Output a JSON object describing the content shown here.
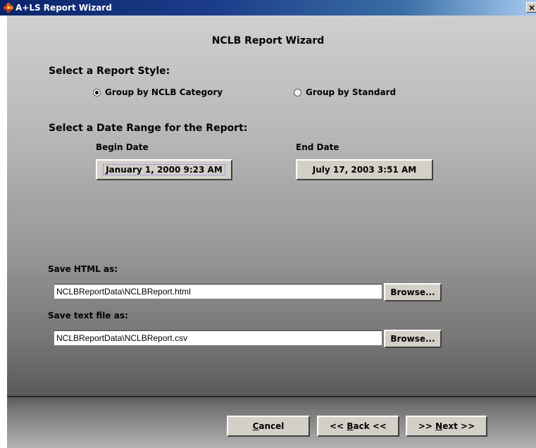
{
  "window": {
    "title": "A+LS Report Wizard",
    "close_glyph": "×"
  },
  "wizard": {
    "header": "NCLB Report Wizard"
  },
  "report_style": {
    "label": "Select a Report Style:",
    "options": [
      {
        "label": "Group by NCLB Category",
        "selected": true
      },
      {
        "label": "Group by Standard",
        "selected": false
      }
    ]
  },
  "date_range": {
    "label": "Select a Date Range for the Report:",
    "begin_label": "Begin Date",
    "begin_value": "January 1, 2000 9:23 AM",
    "end_label": "End Date",
    "end_value": "July 17, 2003 3:51 AM"
  },
  "save_html": {
    "label": "Save HTML as:",
    "value": "NCLBReportData\\NCLBReport.html",
    "browse_label": "Browse..."
  },
  "save_text": {
    "label": "Save text file as:",
    "value": "NCLBReportData\\NCLBReport.csv",
    "browse_label": "Browse..."
  },
  "buttons": {
    "cancel": {
      "mnemonic": "C",
      "rest": "ancel"
    },
    "back": {
      "prefix": "<< ",
      "mnemonic": "B",
      "rest": "ack <<"
    },
    "next": {
      "prefix": ">> ",
      "mnemonic": "N",
      "rest": "ext >>"
    }
  },
  "icons": {
    "app": "app-flower-icon",
    "close": "close-icon"
  }
}
